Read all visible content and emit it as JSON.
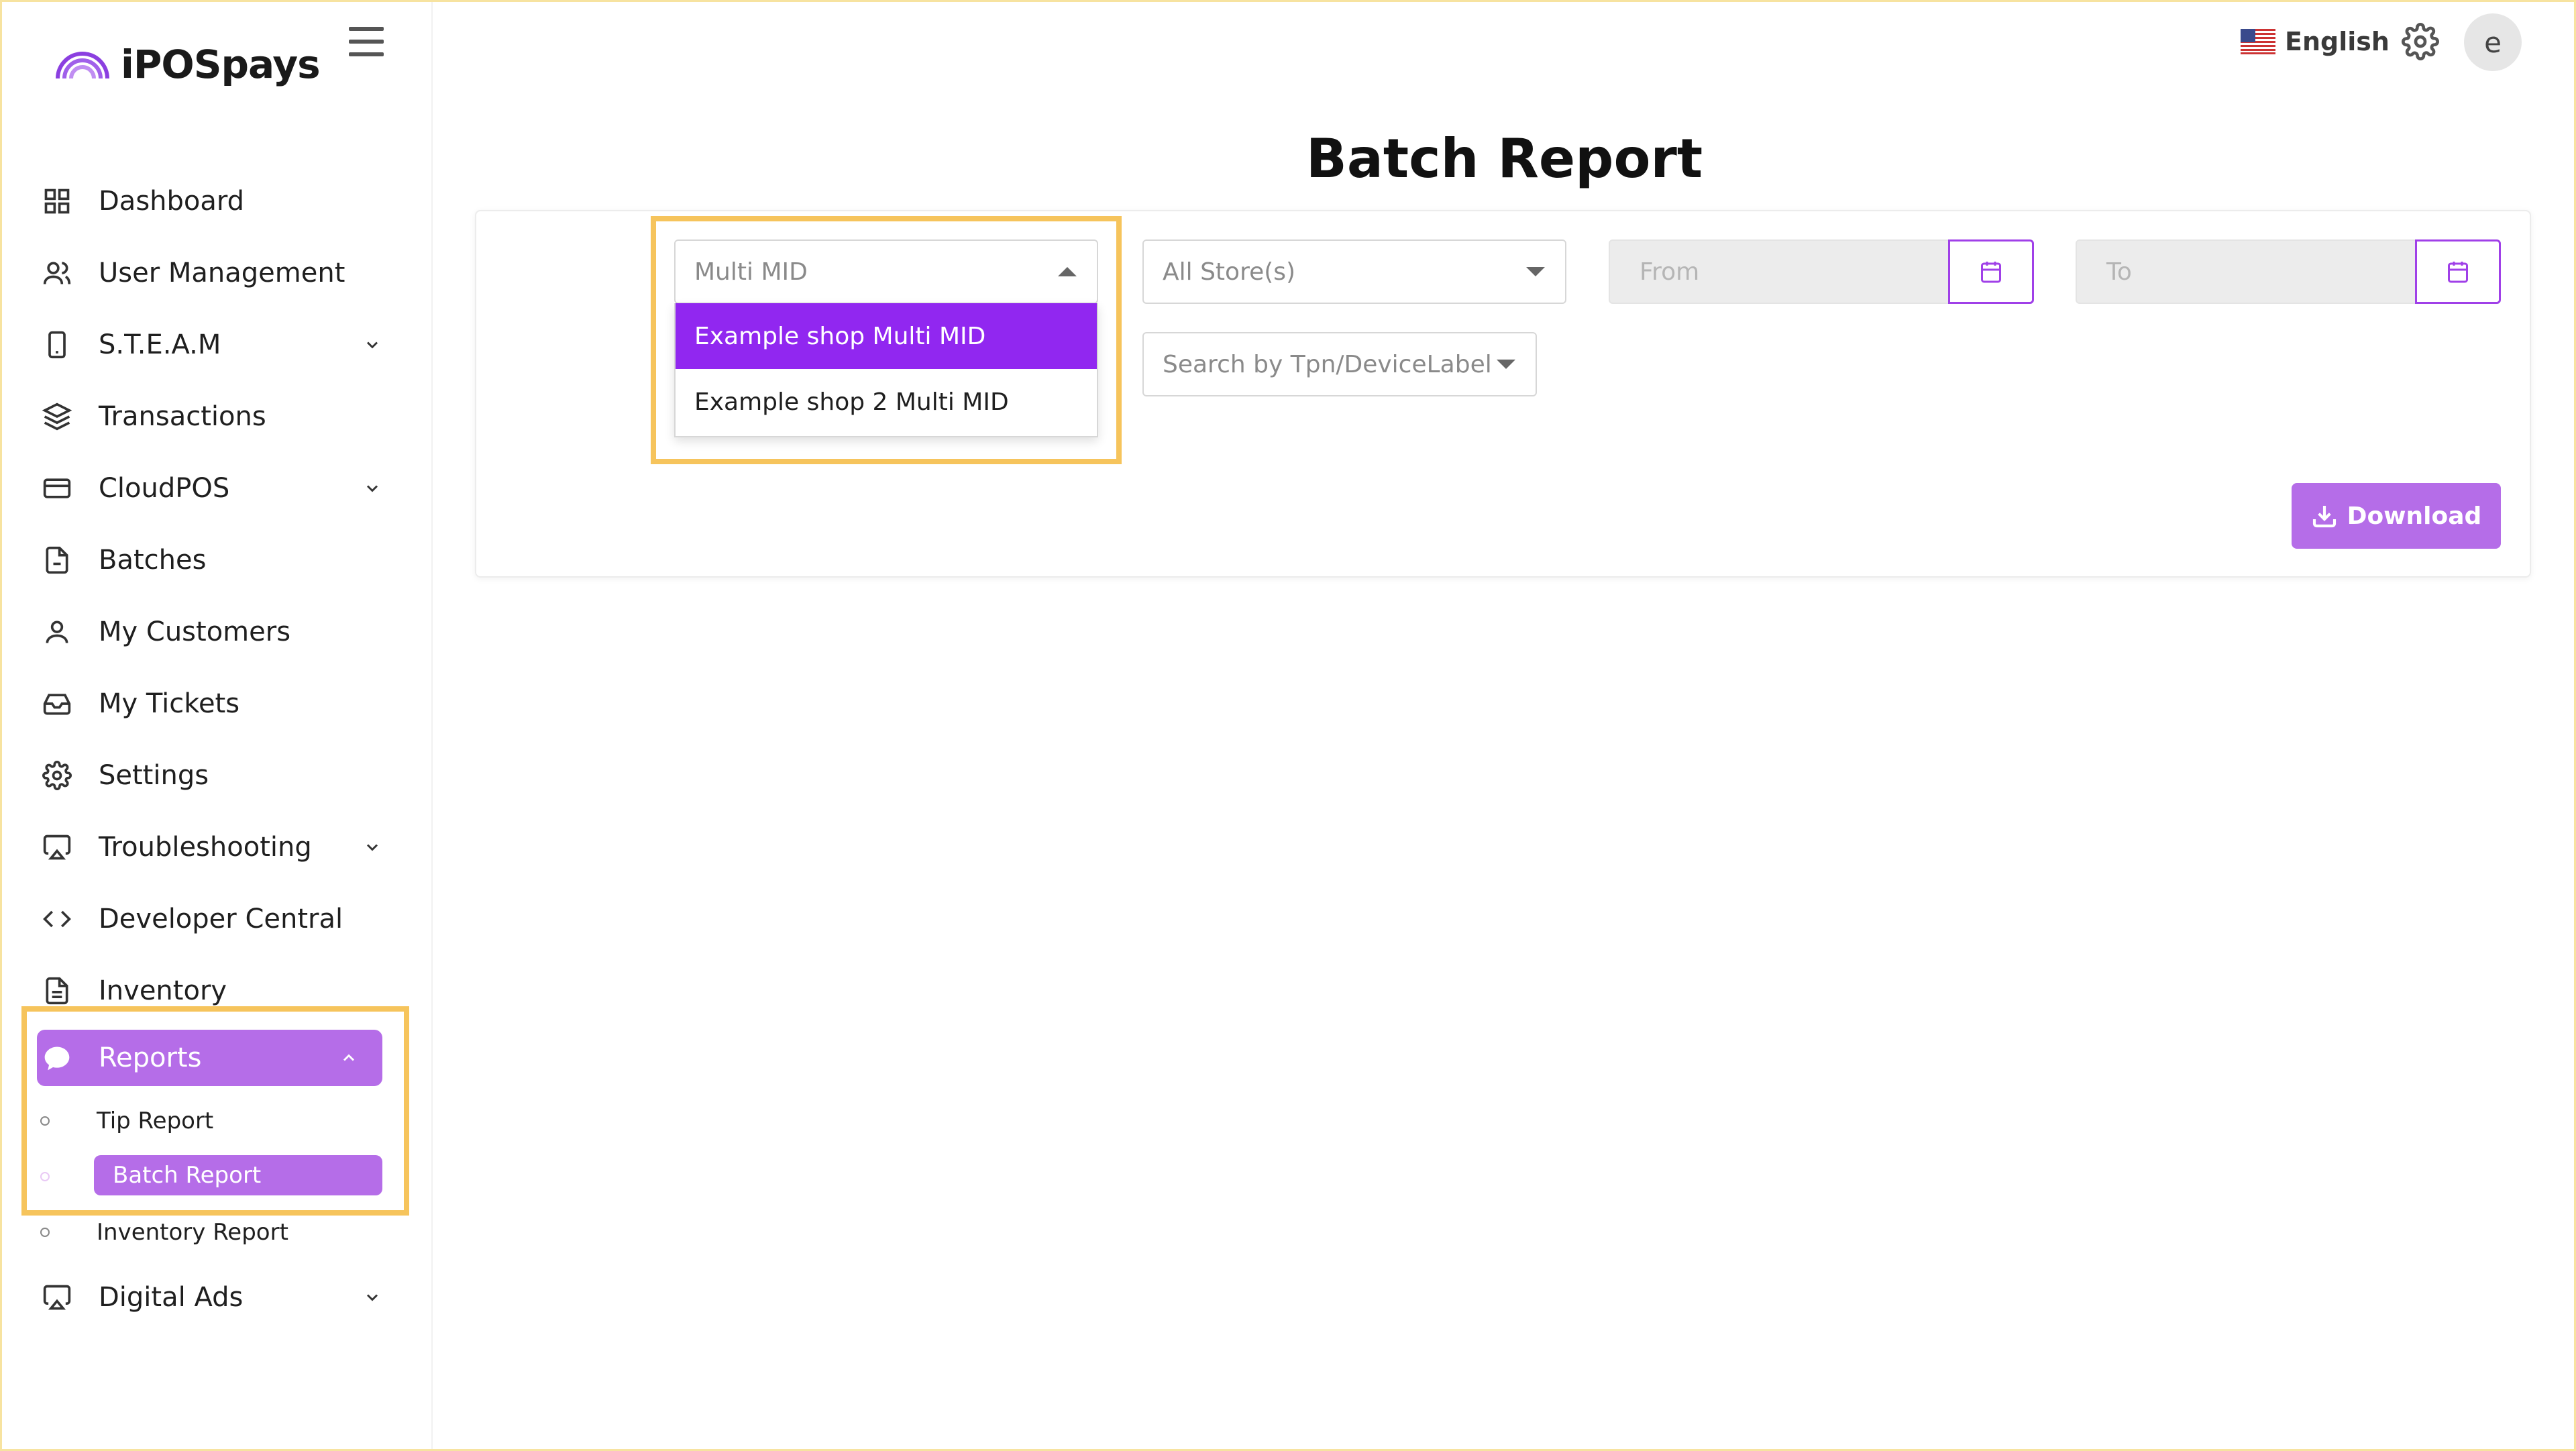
{
  "brand": {
    "name": "iPOSpays"
  },
  "topbar": {
    "language": "English",
    "avatar_initial": "e"
  },
  "sidebar": {
    "items": [
      {
        "label": "Dashboard"
      },
      {
        "label": "User Management"
      },
      {
        "label": "S.T.E.A.M"
      },
      {
        "label": "Transactions"
      },
      {
        "label": "CloudPOS"
      },
      {
        "label": "Batches"
      },
      {
        "label": "My Customers"
      },
      {
        "label": "My Tickets"
      },
      {
        "label": "Settings"
      },
      {
        "label": "Troubleshooting"
      },
      {
        "label": "Developer Central"
      },
      {
        "label": "Inventory"
      },
      {
        "label": "Reports"
      },
      {
        "label": "Digital Ads"
      }
    ],
    "report_sub_items": [
      {
        "label": "Tip Report"
      },
      {
        "label": "Batch Report"
      },
      {
        "label": "Inventory Report"
      }
    ]
  },
  "main": {
    "title": "Batch Report",
    "filters": {
      "multi_mid": {
        "placeholder": "Multi MID",
        "options": [
          "Example shop Multi MID",
          "Example shop 2 Multi MID"
        ],
        "highlighted_option": "Example shop Multi MID"
      },
      "store": {
        "value": "All Store(s)"
      },
      "device": {
        "placeholder": "Search by Tpn/DeviceLabel"
      },
      "from": {
        "placeholder": "From"
      },
      "to": {
        "placeholder": "To"
      }
    },
    "download_label": "Download"
  },
  "colors": {
    "accent": "#b56de8",
    "selected_option": "#9127f0",
    "highlight_box": "#f6c45c"
  }
}
